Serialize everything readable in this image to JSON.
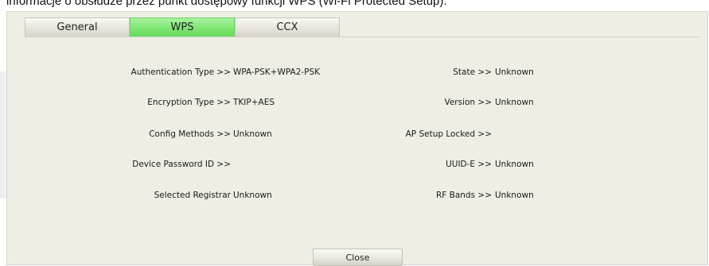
{
  "caption": "informacje o obsłudze przez punkt dostępowy funkcji WPS (Wi-Fi Protected Setup).",
  "tabs": [
    {
      "label": "General",
      "active": false
    },
    {
      "label": "WPS",
      "active": true
    },
    {
      "label": "CCX",
      "active": false
    }
  ],
  "colors": {
    "active_tab": "#7ee673",
    "panel_bg": "#efeee5"
  },
  "left_fields": [
    {
      "label": "Authentication Type >>",
      "value": "WPA-PSK+WPA2-PSK"
    },
    {
      "label": "Encryption Type >>",
      "value": "TKIP+AES"
    },
    {
      "label": "Config Methods >>",
      "value": "Unknown"
    },
    {
      "label": "Device Password ID >>",
      "value": ""
    },
    {
      "label": "Selected Registrar",
      "value": "Unknown"
    }
  ],
  "right_fields": [
    {
      "label": "State >>",
      "value": "Unknown"
    },
    {
      "label": "Version >>",
      "value": "Unknown"
    },
    {
      "label": "AP Setup Locked >>",
      "value": ""
    },
    {
      "label": "UUID-E >>",
      "value": "Unknown"
    },
    {
      "label": "RF Bands >>",
      "value": "Unknown"
    }
  ],
  "close_button": "Close"
}
